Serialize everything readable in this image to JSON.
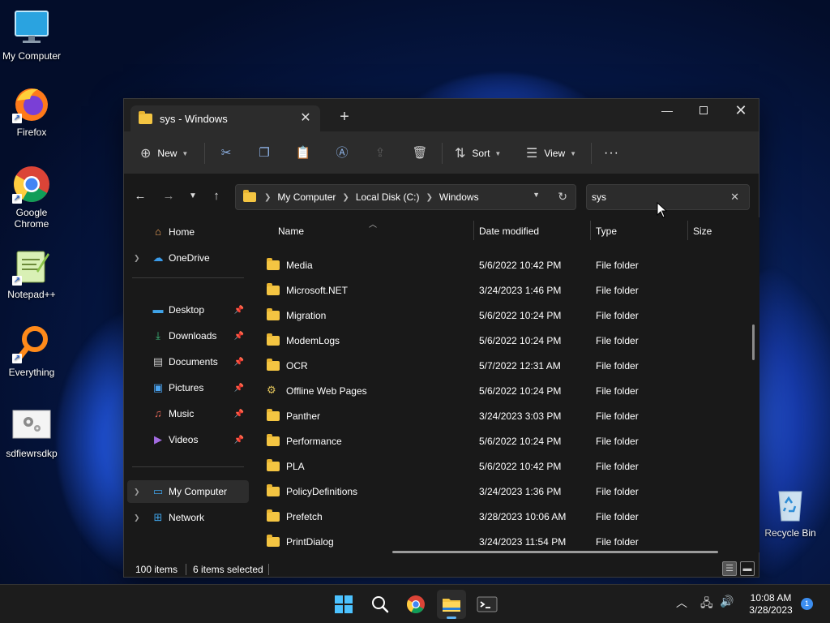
{
  "desktop": {
    "icons": [
      {
        "label": "My Computer"
      },
      {
        "label": "Firefox"
      },
      {
        "label": "Google Chrome"
      },
      {
        "label": "Notepad++"
      },
      {
        "label": "Everything"
      },
      {
        "label": "sdfiewrsdkp"
      },
      {
        "label": "Recycle Bin"
      }
    ]
  },
  "window": {
    "tab_title": "sys - Windows",
    "toolbar": {
      "new_label": "New",
      "sort_label": "Sort",
      "view_label": "View",
      "more_label": "···"
    },
    "address": {
      "crumbs": [
        "My Computer",
        "Local Disk (C:)",
        "Windows"
      ]
    },
    "search": {
      "value": "sys"
    },
    "sidebar": {
      "items": [
        {
          "label": "Home"
        },
        {
          "label": "OneDrive"
        },
        {
          "label": "Desktop"
        },
        {
          "label": "Downloads"
        },
        {
          "label": "Documents"
        },
        {
          "label": "Pictures"
        },
        {
          "label": "Music"
        },
        {
          "label": "Videos"
        },
        {
          "label": "My Computer"
        },
        {
          "label": "Network"
        }
      ]
    },
    "columns": {
      "name": "Name",
      "date": "Date modified",
      "type": "Type",
      "size": "Size"
    },
    "rows": [
      {
        "name": "Media",
        "date": "5/6/2022 10:42 PM",
        "type": "File folder"
      },
      {
        "name": "Microsoft.NET",
        "date": "3/24/2023 1:46 PM",
        "type": "File folder"
      },
      {
        "name": "Migration",
        "date": "5/6/2022 10:24 PM",
        "type": "File folder"
      },
      {
        "name": "ModemLogs",
        "date": "5/6/2022 10:24 PM",
        "type": "File folder"
      },
      {
        "name": "OCR",
        "date": "5/7/2022 12:31 AM",
        "type": "File folder"
      },
      {
        "name": "Offline Web Pages",
        "date": "5/6/2022 10:24 PM",
        "type": "File folder"
      },
      {
        "name": "Panther",
        "date": "3/24/2023 3:03 PM",
        "type": "File folder"
      },
      {
        "name": "Performance",
        "date": "5/6/2022 10:24 PM",
        "type": "File folder"
      },
      {
        "name": "PLA",
        "date": "5/6/2022 10:42 PM",
        "type": "File folder"
      },
      {
        "name": "PolicyDefinitions",
        "date": "3/24/2023 1:36 PM",
        "type": "File folder"
      },
      {
        "name": "Prefetch",
        "date": "3/28/2023 10:06 AM",
        "type": "File folder"
      },
      {
        "name": "PrintDialog",
        "date": "3/24/2023 11:54 PM",
        "type": "File folder"
      }
    ],
    "status": {
      "items": "100 items",
      "selected": "6 items selected"
    }
  },
  "taskbar": {
    "time": "10:08 AM",
    "date": "3/28/2023",
    "notification_count": "1"
  },
  "colors": {
    "folder": "#f4c542",
    "accent": "#5fb2f2",
    "window_bg": "#191919",
    "toolbar_bg": "#2c2c2c"
  }
}
